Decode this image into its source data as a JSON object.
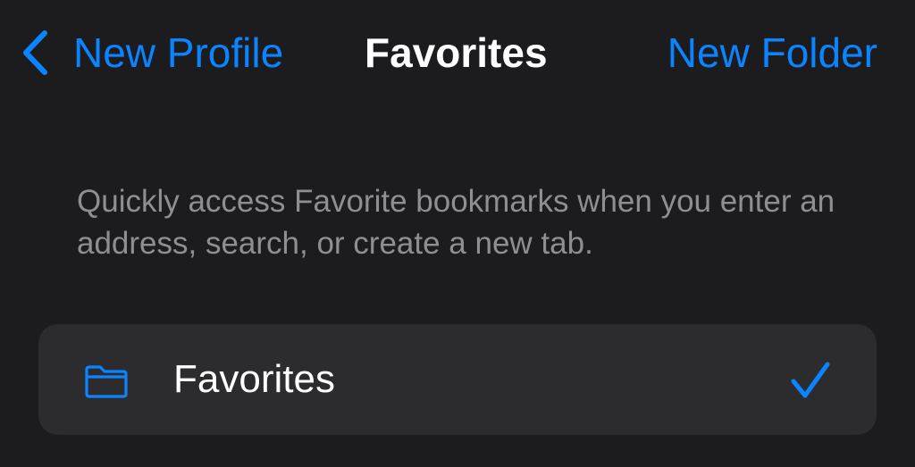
{
  "nav": {
    "back_label": "New Profile",
    "title": "Favorites",
    "new_folder_label": "New Folder"
  },
  "description": "Quickly access Favorite bookmarks when you enter an address, search, or create a new tab.",
  "folders": [
    {
      "label": "Favorites",
      "icon": "folder-icon",
      "selected": true
    }
  ],
  "colors": {
    "background": "#1c1c1e",
    "accent": "#0a84ff",
    "group_background": "#2c2c2e",
    "secondary_text": "#8e8e93",
    "primary_text": "#ffffff"
  }
}
